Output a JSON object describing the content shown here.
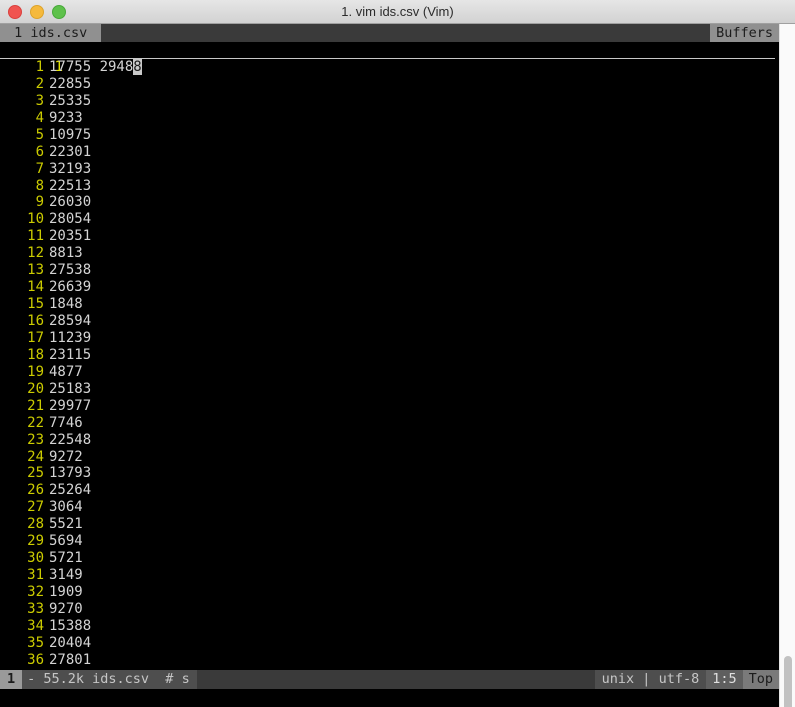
{
  "window": {
    "title": "1. vim ids.csv (Vim)",
    "controls": [
      {
        "name": "close",
        "color": "#f0534f"
      },
      {
        "name": "minimize",
        "color": "#f5b93c"
      },
      {
        "name": "zoom",
        "color": "#5ec14b"
      }
    ]
  },
  "tabline": {
    "active_tab": " 1 ids.csv ",
    "buffers_label": "Buffers"
  },
  "editor": {
    "cursor_line_number": "1",
    "cursor_line_text_before": "2948",
    "cursor_line_text_cursor": "8",
    "lines": [
      {
        "num": "1",
        "value": "17755"
      },
      {
        "num": "2",
        "value": "22855"
      },
      {
        "num": "3",
        "value": "25335"
      },
      {
        "num": "4",
        "value": "9233"
      },
      {
        "num": "5",
        "value": "10975"
      },
      {
        "num": "6",
        "value": "22301"
      },
      {
        "num": "7",
        "value": "32193"
      },
      {
        "num": "8",
        "value": "22513"
      },
      {
        "num": "9",
        "value": "26030"
      },
      {
        "num": "10",
        "value": "28054"
      },
      {
        "num": "11",
        "value": "20351"
      },
      {
        "num": "12",
        "value": "8813"
      },
      {
        "num": "13",
        "value": "27538"
      },
      {
        "num": "14",
        "value": "26639"
      },
      {
        "num": "15",
        "value": "1848"
      },
      {
        "num": "16",
        "value": "28594"
      },
      {
        "num": "17",
        "value": "11239"
      },
      {
        "num": "18",
        "value": "23115"
      },
      {
        "num": "19",
        "value": "4877"
      },
      {
        "num": "20",
        "value": "25183"
      },
      {
        "num": "21",
        "value": "29977"
      },
      {
        "num": "22",
        "value": "7746"
      },
      {
        "num": "23",
        "value": "22548"
      },
      {
        "num": "24",
        "value": "9272"
      },
      {
        "num": "25",
        "value": "13793"
      },
      {
        "num": "26",
        "value": "25264"
      },
      {
        "num": "27",
        "value": "3064"
      },
      {
        "num": "28",
        "value": "5521"
      },
      {
        "num": "29",
        "value": "5694"
      },
      {
        "num": "30",
        "value": "5721"
      },
      {
        "num": "31",
        "value": "3149"
      },
      {
        "num": "32",
        "value": "1909"
      },
      {
        "num": "33",
        "value": "9270"
      },
      {
        "num": "34",
        "value": "15388"
      },
      {
        "num": "35",
        "value": "20404"
      },
      {
        "num": "36",
        "value": "27801"
      }
    ]
  },
  "statusline": {
    "mode": "1",
    "fileinfo": "- 55.2k ids.csv  # s",
    "encoding": "unix | utf-8",
    "position": "1:5",
    "scroll": "Top"
  },
  "colors": {
    "background": "#000000",
    "line_number": "#cccc00",
    "text": "#d4d4d4",
    "tab_active_bg": "#909090",
    "tabline_bg": "#3a3a3a",
    "status_mode_bg": "#9a9a9a",
    "cursor": "#c9c9c9"
  }
}
